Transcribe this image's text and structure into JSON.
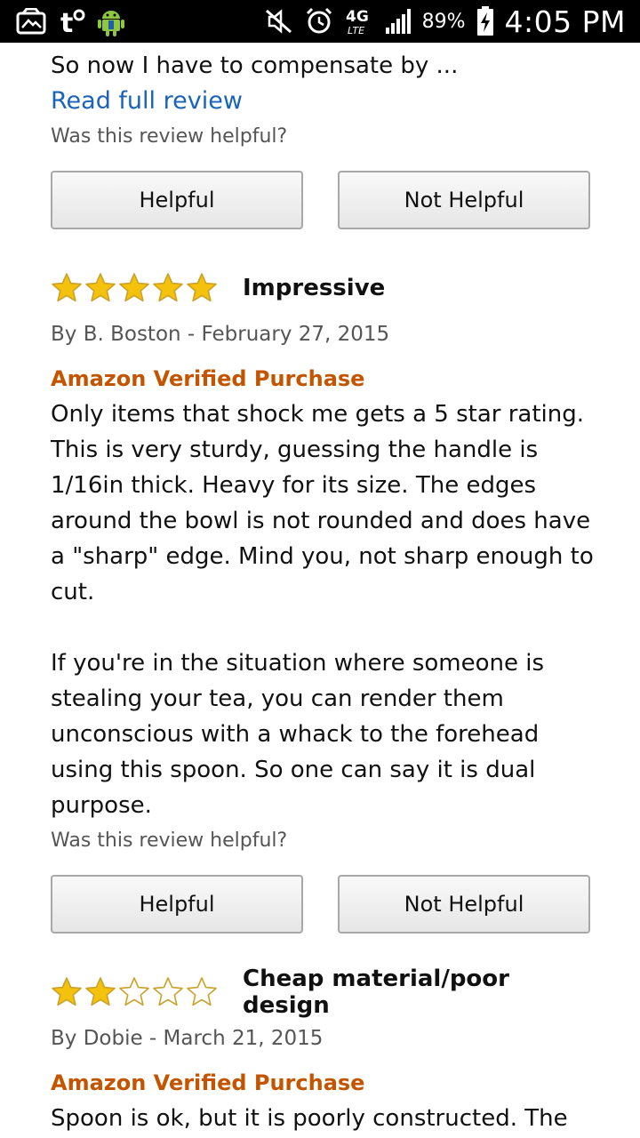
{
  "status_bar": {
    "battery": "89%",
    "time": "4:05 PM",
    "network": "4G",
    "left_icons": [
      "gallery-notification-icon",
      "t-mobile-icon",
      "android-icon"
    ],
    "right_icons": [
      "mute-icon",
      "alarm-icon",
      "4g-lte-icon",
      "signal-icon",
      "battery-charging-icon"
    ]
  },
  "previous_review": {
    "text_tail": "So now I have to compensate by ...",
    "read_full": "Read full review",
    "helpful_question": "Was this review helpful?",
    "helpful_label": "Helpful",
    "not_helpful_label": "Not Helpful"
  },
  "reviews": [
    {
      "rating": 5,
      "title": "Impressive",
      "byline": "By B. Boston - February 27, 2015",
      "verified": "Amazon Verified Purchase",
      "body": "Only items that shock me gets a 5 star rating. This is very sturdy, guessing the handle is 1/16in thick. Heavy for its size. The edges around the bowl is not rounded and does have a \"sharp\" edge. Mind you, not sharp enough to cut.\n\nIf you're in the situation where someone is stealing your tea, you can render them unconscious with a whack to the forehead using this spoon. So one can say it is dual purpose.",
      "helpful_question": "Was this review helpful?",
      "helpful_label": "Helpful",
      "not_helpful_label": "Not Helpful"
    },
    {
      "rating": 2,
      "title": "Cheap material/poor design",
      "byline": "By Dobie - March 21, 2015",
      "verified": "Amazon Verified Purchase",
      "body": "Spoon is ok, but it is poorly constructed. The"
    }
  ],
  "colors": {
    "link": "#1a63b8",
    "verified": "#c45500",
    "star_fill": "#f4c20d",
    "star_outline": "#c9a227"
  }
}
